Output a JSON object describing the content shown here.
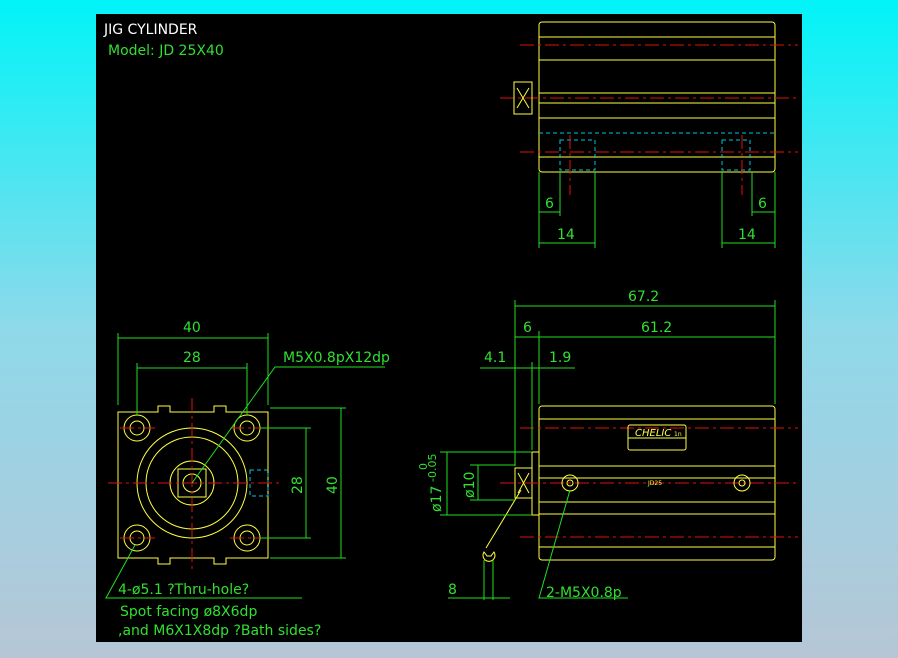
{
  "title": "JIG CYLINDER",
  "model": "Model:  JD 25X40",
  "dims": {
    "top_left_6": "6",
    "top_right_6": "6",
    "top_left_14": "14",
    "top_right_14": "14",
    "width_40": "40",
    "width_28": "28",
    "height_28": "28",
    "height_40": "40",
    "thread": "M5X0.8pX12dp",
    "len_67_2": "67.2",
    "len_6": "6",
    "len_61_2": "61.2",
    "len_4_1": "4.1",
    "len_1_9": "1.9",
    "dia17": "ø17",
    "dia17_tol": "-0.05",
    "dia17_tol_upper": "0",
    "dia10": "ø10",
    "wrench_8": "8",
    "port": "2-M5X0.8p"
  },
  "notes": [
    "4-ø5.1 ?Thru-hole?",
    "Spot facing  ø8X6dp",
    ",and M6X1X8dp ?Bath sides?"
  ],
  "label": {
    "brand": "CHELIC",
    "suffix": "1n",
    "body_mark": "JD25"
  },
  "colors": {
    "outline": "#ffff40",
    "dimension": "#20e020",
    "centerline": "#e01010",
    "hidden": "#00c8e0"
  }
}
